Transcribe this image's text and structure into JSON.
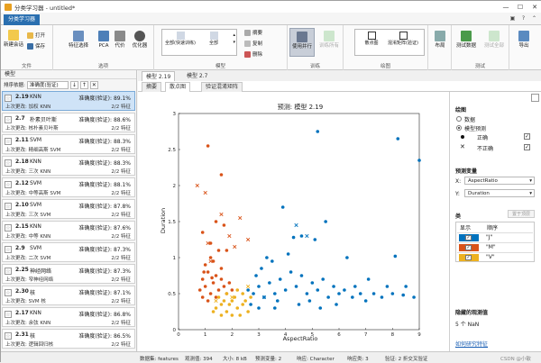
{
  "window": {
    "title": "分类学习器 - untitled*",
    "controls": [
      "—",
      "☐",
      "✕"
    ]
  },
  "app_tab": "分类学习器",
  "ribbon": {
    "file": {
      "new_session": "新建会话",
      "open": "打开",
      "save": "保存",
      "label": "文件"
    },
    "options": {
      "feature_selection": "特征选择",
      "pca": "PCA",
      "cost": "代价",
      "optimizer": "优化器",
      "label": "选项"
    },
    "models": {
      "gallery_item1": "全部(快速训练)",
      "gallery_item2": "全部",
      "duplicate": "摘要",
      "copy": "复制",
      "delete": "删除",
      "label": "模型"
    },
    "train": {
      "parallel": "使用并行",
      "train_all": "训练所有",
      "label": "训练"
    },
    "plot": {
      "scatter": "散点图",
      "confusion": "混淆矩阵(验证)",
      "label": "绘图"
    },
    "layout": {
      "label": "布局"
    },
    "test": {
      "test_data": "测试数据",
      "test_all": "测试全部",
      "label": "测试"
    },
    "export": {
      "label": "导出"
    }
  },
  "left_panel": {
    "header": "模型",
    "sort_label": "排序依据:",
    "sort_value": "准确度(验证)",
    "items": [
      {
        "id": "2.19",
        "type": "KNN",
        "acc": "准确度(验证): 89.1%",
        "last": "上次更改: 加权 KNN",
        "feat": "2/2 特征",
        "selected": true
      },
      {
        "id": "2.7",
        "type": "朴素贝叶斯",
        "acc": "准确度(验证): 88.6%",
        "last": "上次更改: 核朴素贝叶斯",
        "feat": "2/2 特征"
      },
      {
        "id": "2.11",
        "type": "SVM",
        "acc": "准确度(验证): 88.3%",
        "last": "上次更改: 精细高斯 SVM",
        "feat": "2/2 特征"
      },
      {
        "id": "2.18",
        "type": "KNN",
        "acc": "准确度(验证): 88.3%",
        "last": "上次更改: 三次 KNN",
        "feat": "2/2 特征"
      },
      {
        "id": "2.12",
        "type": "SVM",
        "acc": "准确度(验证): 88.1%",
        "last": "上次更改: 中等高斯 SVM",
        "feat": "2/2 特征"
      },
      {
        "id": "2.10",
        "type": "SVM",
        "acc": "准确度(验证): 87.8%",
        "last": "上次更改: 三次 SVM",
        "feat": "2/2 特征"
      },
      {
        "id": "2.15",
        "type": "KNN",
        "acc": "准确度(验证): 87.6%",
        "last": "上次更改: 中等 KNN",
        "feat": "2/2 特征"
      },
      {
        "id": "2.9",
        "type": "SVM",
        "acc": "准确度(验证): 87.3%",
        "last": "上次更改: 二次 SVM",
        "feat": "2/2 特征"
      },
      {
        "id": "2.25",
        "type": "神经网络",
        "acc": "准确度(验证): 87.3%",
        "last": "上次更改: 窄神经网络",
        "feat": "2/2 特征"
      },
      {
        "id": "2.30",
        "type": "核",
        "acc": "准确度(验证): 87.1%",
        "last": "上次更改: SVM 核",
        "feat": "2/2 特征"
      },
      {
        "id": "2.17",
        "type": "KNN",
        "acc": "准确度(验证): 86.8%",
        "last": "上次更改: 余弦 KNN",
        "feat": "2/2 特征"
      },
      {
        "id": "2.31",
        "type": "核",
        "acc": "准确度(验证): 86.5%",
        "last": "上次更改: 逻辑回归核",
        "feat": "2/2 特征"
      }
    ]
  },
  "doc_tabs": [
    "模型 2.19",
    "模型 2.7"
  ],
  "view_tabs": [
    "摘要",
    "散点图",
    "验证混淆矩阵"
  ],
  "chart_data": {
    "type": "scatter",
    "title": "预测: 模型 2.19",
    "xlabel": "AspectRatio",
    "ylabel": "Duration",
    "xlim": [
      0,
      9
    ],
    "ylim": [
      0,
      3
    ],
    "xticks": [
      0,
      1,
      2,
      3,
      4,
      5,
      6,
      7,
      8,
      9
    ],
    "yticks": [
      0,
      0.5,
      1,
      1.5,
      2,
      2.5,
      3
    ],
    "series": [
      {
        "name": "J",
        "color": "#0072BD",
        "points": [
          [
            2.6,
            0.55
          ],
          [
            2.8,
            0.5
          ],
          [
            3.0,
            0.6
          ],
          [
            3.2,
            0.45
          ],
          [
            3.4,
            0.65
          ],
          [
            3.6,
            0.5
          ],
          [
            3.8,
            0.7
          ],
          [
            4.0,
            0.55
          ],
          [
            4.2,
            0.8
          ],
          [
            4.4,
            0.6
          ],
          [
            4.6,
            0.75
          ],
          [
            4.8,
            0.5
          ],
          [
            5.0,
            0.65
          ],
          [
            5.2,
            0.55
          ],
          [
            5.4,
            0.7
          ],
          [
            5.6,
            0.45
          ],
          [
            5.8,
            0.6
          ],
          [
            6.0,
            0.5
          ],
          [
            6.2,
            0.55
          ],
          [
            6.5,
            0.45
          ],
          [
            6.8,
            0.5
          ],
          [
            7.0,
            0.4
          ],
          [
            7.3,
            0.5
          ],
          [
            7.6,
            0.45
          ],
          [
            8.0,
            0.5
          ],
          [
            8.4,
            0.48
          ],
          [
            8.8,
            0.45
          ],
          [
            3.1,
            0.85
          ],
          [
            3.5,
            0.95
          ],
          [
            4.1,
            1.05
          ],
          [
            4.6,
            1.3
          ],
          [
            5.1,
            1.25
          ],
          [
            5.5,
            1.5
          ],
          [
            6.3,
            1.0
          ],
          [
            3.9,
            1.7
          ],
          [
            5.2,
            2.75
          ],
          [
            8.2,
            2.65
          ],
          [
            9.0,
            2.35
          ],
          [
            8.1,
            1.02
          ],
          [
            4.3,
            1.28
          ],
          [
            3.3,
            1.0
          ],
          [
            2.9,
            0.75
          ],
          [
            3.7,
            0.4
          ],
          [
            4.9,
            0.4
          ],
          [
            5.9,
            0.35
          ],
          [
            6.6,
            0.6
          ],
          [
            7.1,
            0.7
          ],
          [
            7.8,
            0.6
          ],
          [
            8.5,
            0.6
          ],
          [
            2.7,
            0.35
          ],
          [
            3.6,
            0.3
          ],
          [
            4.5,
            0.35
          ],
          [
            5.3,
            0.3
          ],
          [
            3.0,
            0.3
          ]
        ]
      },
      {
        "name": "M",
        "color": "#D95319",
        "points": [
          [
            0.8,
            0.55
          ],
          [
            0.9,
            0.7
          ],
          [
            1.0,
            0.6
          ],
          [
            1.1,
            0.8
          ],
          [
            1.2,
            0.5
          ],
          [
            1.3,
            0.65
          ],
          [
            1.4,
            0.75
          ],
          [
            1.5,
            0.55
          ],
          [
            1.6,
            0.7
          ],
          [
            1.7,
            0.6
          ],
          [
            1.8,
            0.5
          ],
          [
            0.9,
            0.45
          ],
          [
            1.0,
            0.9
          ],
          [
            1.2,
            1.0
          ],
          [
            1.4,
            0.45
          ],
          [
            1.6,
            0.85
          ],
          [
            1.9,
            0.65
          ],
          [
            2.0,
            0.55
          ],
          [
            1.1,
            0.4
          ],
          [
            1.3,
            0.95
          ],
          [
            1.5,
            1.1
          ],
          [
            1.2,
            1.2
          ],
          [
            0.9,
            1.35
          ],
          [
            1.4,
            1.5
          ],
          [
            1.7,
            1.45
          ],
          [
            1.1,
            2.55
          ],
          [
            1.6,
            2.15
          ],
          [
            1.8,
            1.1
          ],
          [
            0.95,
            0.8
          ],
          [
            1.25,
            0.72
          ]
        ]
      },
      {
        "name": "V",
        "color": "#EDB120",
        "points": [
          [
            1.4,
            0.3
          ],
          [
            1.6,
            0.35
          ],
          [
            1.8,
            0.25
          ],
          [
            2.0,
            0.4
          ],
          [
            2.2,
            0.3
          ],
          [
            2.4,
            0.35
          ],
          [
            2.6,
            0.25
          ],
          [
            1.5,
            0.45
          ],
          [
            1.7,
            0.4
          ],
          [
            1.9,
            0.35
          ],
          [
            2.1,
            0.45
          ],
          [
            2.3,
            0.2
          ],
          [
            2.5,
            0.4
          ],
          [
            1.3,
            0.25
          ],
          [
            2.0,
            0.2
          ],
          [
            2.2,
            0.55
          ],
          [
            2.4,
            0.5
          ],
          [
            1.6,
            0.2
          ],
          [
            1.8,
            0.5
          ],
          [
            2.7,
            0.45
          ]
        ]
      }
    ],
    "incorrect": [
      [
        0.7,
        2.0
      ],
      [
        1.0,
        1.9
      ],
      [
        1.6,
        1.6
      ],
      [
        2.3,
        1.55
      ],
      [
        1.1,
        1.2
      ],
      [
        1.9,
        1.3
      ],
      [
        2.1,
        1.15
      ],
      [
        2.6,
        1.25
      ],
      [
        4.4,
        1.45
      ],
      [
        4.8,
        1.3
      ],
      [
        1.4,
        0.4
      ],
      [
        2.6,
        0.6
      ],
      [
        2.0,
        0.45
      ],
      [
        3.2,
        0.45
      ],
      [
        1.2,
        0.95
      ]
    ]
  },
  "settings": {
    "plot_title": "绘图",
    "opt_data": "数据",
    "opt_predictions": "模型预测",
    "correct": "正确",
    "incorrect": "不正确",
    "predictors_title": "预测变量",
    "x_label": "X:",
    "x_value": "AspectRatio",
    "y_label": "Y:",
    "y_value": "Duration",
    "classes_title": "类",
    "move_top": "置于顶层",
    "show_col": "显示",
    "order_col": "顺序",
    "classes": [
      {
        "name": "\"J\"",
        "color": "#0072BD"
      },
      {
        "name": "\"M\"",
        "color": "#D95319"
      },
      {
        "name": "\"V\"",
        "color": "#EDB120"
      }
    ],
    "hidden_title": "隐藏的观测值",
    "hidden_value": "5 个 NaN",
    "help_link": "如何研究特征"
  },
  "status": {
    "dataset": "数据集: features",
    "obs": "观测值: 394",
    "size": "大小: 8 kB",
    "predictors": "预测变量: 2",
    "response": "响应: Character",
    "classes": "响应类: 3",
    "validation": "验证: 2 折交叉验证"
  },
  "watermark": "CSDN @小敏"
}
